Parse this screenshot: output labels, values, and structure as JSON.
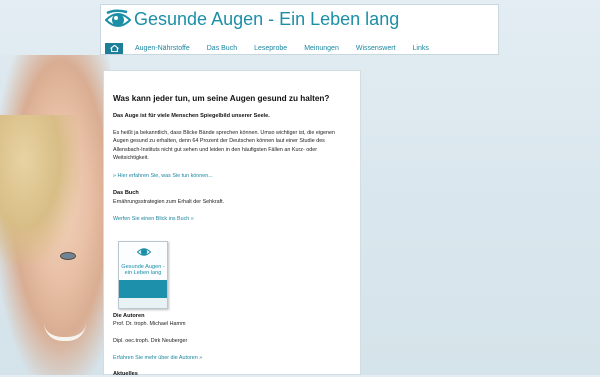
{
  "header": {
    "site_title": "Gesunde Augen - Ein Leben lang"
  },
  "nav": {
    "items": [
      "Augen-Nährstoffe",
      "Das Buch",
      "Leseprobe",
      "Meinungen",
      "Wissenswert",
      "Links"
    ]
  },
  "content": {
    "heading": "Was kann jeder tun, um seine Augen gesund zu halten?",
    "subheading": "Das Auge ist für viele Menschen Spiegelbild unserer Seele.",
    "paragraph": "Es heißt ja bekanntlich, dass Blicke Bände sprechen können. Umso wichtiger ist, die eigenen Augen gesund zu erhalten, denn 64 Prozent der Deutschen können laut einer Studie des Allensbach-Instituts nicht gut sehen und leiden in den häufigsten Fällen an Kurz- oder Weitsichtigkeit.",
    "link_more": "» Hier erfahren Sie, was Sie tun können...",
    "book_label": "Das Buch",
    "book_desc": "Ernährungsstrategien zum Erhalt der Sehkraft.",
    "book_link": "Werfen Sie einen Blick ins Buch »",
    "book_cover_title": "Gesunde Augen - ein Leben lang",
    "authors_label": "Die Autoren",
    "author1": "Prof. Dr. troph. Michael Hamm",
    "author2": "Dipl. oec.troph. Dirk Neuberger",
    "authors_link": "Erfahren Sie mehr über die Autoren »",
    "cutoff_label": "Aktuelles"
  },
  "colors": {
    "brand": "#1c8fa7",
    "nav_home_bg": "#1d7e99"
  },
  "icons": {
    "logo": "eye-logo-icon",
    "home": "home-icon"
  }
}
